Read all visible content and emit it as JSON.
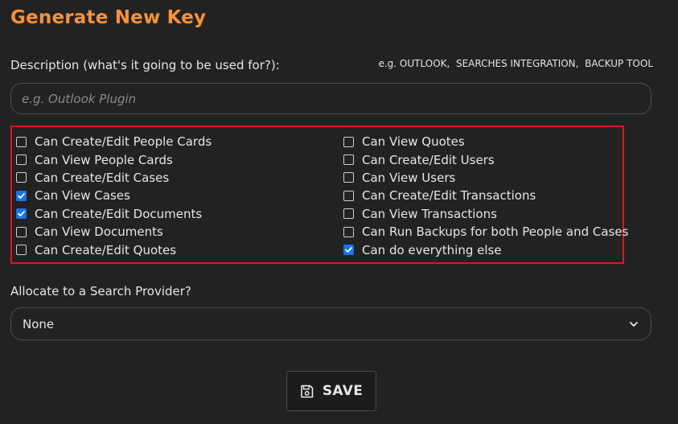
{
  "form": {
    "title": "Generate New Key",
    "description_label": "Description (what's it going to be used for?):",
    "examples_hint": "e.g. OUTLOOK,  SEARCHES INTEGRATION,  BACKUP TOOL",
    "description_value": "",
    "description_placeholder": "e.g. Outlook Plugin",
    "save_label": "SAVE",
    "save_icon": "floppy-disk-icon"
  },
  "permissions": {
    "left": [
      {
        "label": "Can Create/Edit People Cards",
        "checked": false
      },
      {
        "label": "Can View People Cards",
        "checked": false
      },
      {
        "label": "Can Create/Edit Cases",
        "checked": false
      },
      {
        "label": "Can View Cases",
        "checked": true
      },
      {
        "label": "Can Create/Edit Documents",
        "checked": true
      },
      {
        "label": "Can View Documents",
        "checked": false
      },
      {
        "label": "Can Create/Edit Quotes",
        "checked": false
      }
    ],
    "right": [
      {
        "label": "Can View Quotes",
        "checked": false
      },
      {
        "label": "Can Create/Edit Users",
        "checked": false
      },
      {
        "label": "Can View Users",
        "checked": false
      },
      {
        "label": "Can Create/Edit Transactions",
        "checked": false
      },
      {
        "label": "Can View Transactions",
        "checked": false
      },
      {
        "label": "Can Run Backups for both People and Cases",
        "checked": false
      },
      {
        "label": "Can do everything else",
        "checked": true
      }
    ]
  },
  "search_provider": {
    "label": "Allocate to a Search Provider?",
    "selected": "None",
    "icon": "chevron-down-icon"
  },
  "colors": {
    "background": "#222222",
    "title": "#f5923a",
    "highlight_border": "#e0141c",
    "checkbox_checked": "#1a73e8",
    "input_border": "#4d4d4d"
  }
}
